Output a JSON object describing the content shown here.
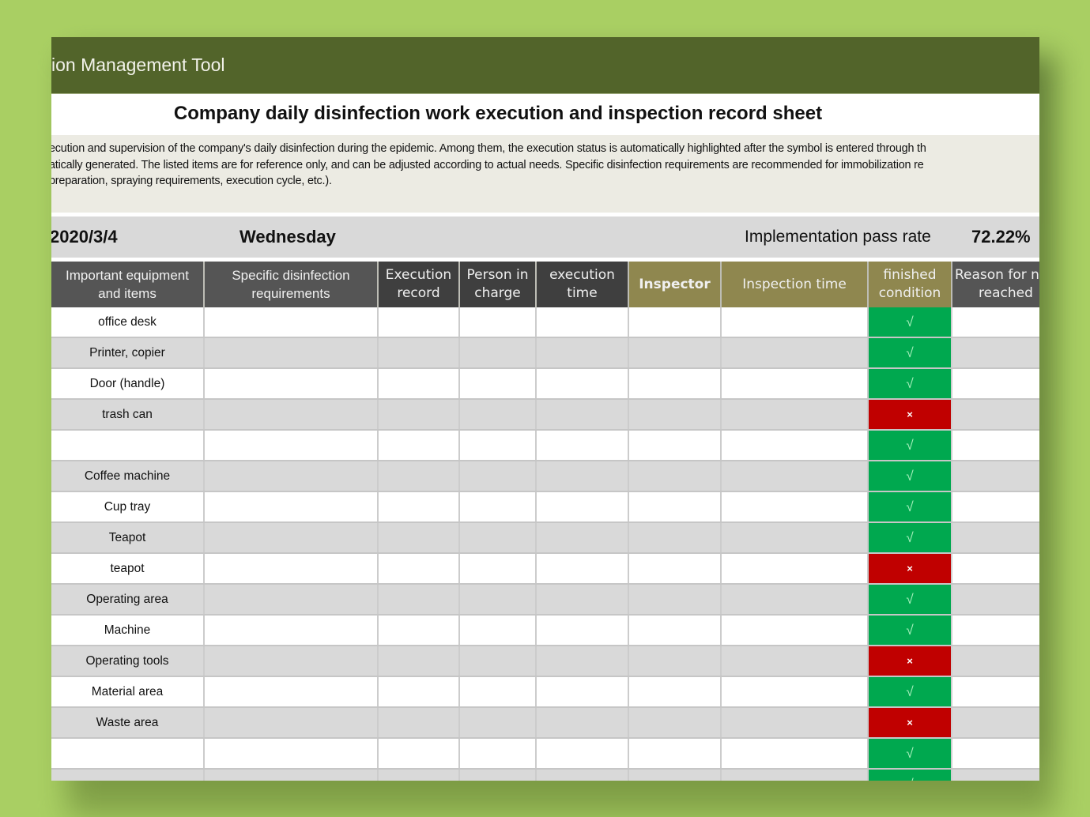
{
  "app": {
    "title": "ion Management Tool"
  },
  "sheet": {
    "heading": "Company daily disinfection work execution and inspection record sheet",
    "description": [
      "ecution and supervision of the company's daily disinfection during the epidemic. Among them, the execution status is automatically highlighted after the symbol is entered through th",
      "atically generated. The listed items are for reference only, and can be adjusted according to actual needs. Specific disinfection requirements are recommended for immobilization re",
      "preparation, spraying requirements, execution cycle, etc.)."
    ],
    "date": "2020/3/4",
    "weekday": "Wednesday",
    "pass_rate_label": "Implementation pass rate",
    "pass_rate_value": "72.22%"
  },
  "table": {
    "columns": [
      {
        "line1": "Important equipment",
        "line2": "and items"
      },
      {
        "line1": "Specific disinfection",
        "line2": "requirements"
      },
      {
        "line1": "Execution",
        "line2": "record"
      },
      {
        "line1": "Person in",
        "line2": "charge"
      },
      {
        "line1": "execution",
        "line2": "time"
      },
      {
        "line1": "Inspector",
        "line2": ""
      },
      {
        "line1": "Inspection time",
        "line2": ""
      },
      {
        "line1": "finished",
        "line2": "condition"
      },
      {
        "line1": "Reason for n",
        "line2": "reached"
      }
    ],
    "rows": [
      {
        "item": "office desk",
        "status": "√",
        "state": "pass"
      },
      {
        "item": "Printer, copier",
        "status": "√",
        "state": "pass"
      },
      {
        "item": "Door (handle)",
        "status": "√",
        "state": "pass"
      },
      {
        "item": "trash can",
        "status": "×",
        "state": "fail"
      },
      {
        "item": "",
        "status": "√",
        "state": "pass"
      },
      {
        "item": "Coffee machine",
        "status": "√",
        "state": "pass"
      },
      {
        "item": "Cup tray",
        "status": "√",
        "state": "pass"
      },
      {
        "item": "Teapot",
        "status": "√",
        "state": "pass"
      },
      {
        "item": "teapot",
        "status": "×",
        "state": "fail"
      },
      {
        "item": "Operating area",
        "status": "√",
        "state": "pass"
      },
      {
        "item": "Machine",
        "status": "√",
        "state": "pass"
      },
      {
        "item": "Operating tools",
        "status": "×",
        "state": "fail"
      },
      {
        "item": "Material area",
        "status": "√",
        "state": "pass"
      },
      {
        "item": "Waste area",
        "status": "×",
        "state": "fail"
      },
      {
        "item": "",
        "status": "√",
        "state": "pass"
      },
      {
        "item": "",
        "status": "√",
        "state": "pass"
      }
    ]
  },
  "colors": {
    "title_bar": "#52642a",
    "pass": "#00a84f",
    "fail": "#c00000",
    "header_dark": "#3f3f3f",
    "header_olive": "#8f874f",
    "background": "#a9cf63"
  }
}
